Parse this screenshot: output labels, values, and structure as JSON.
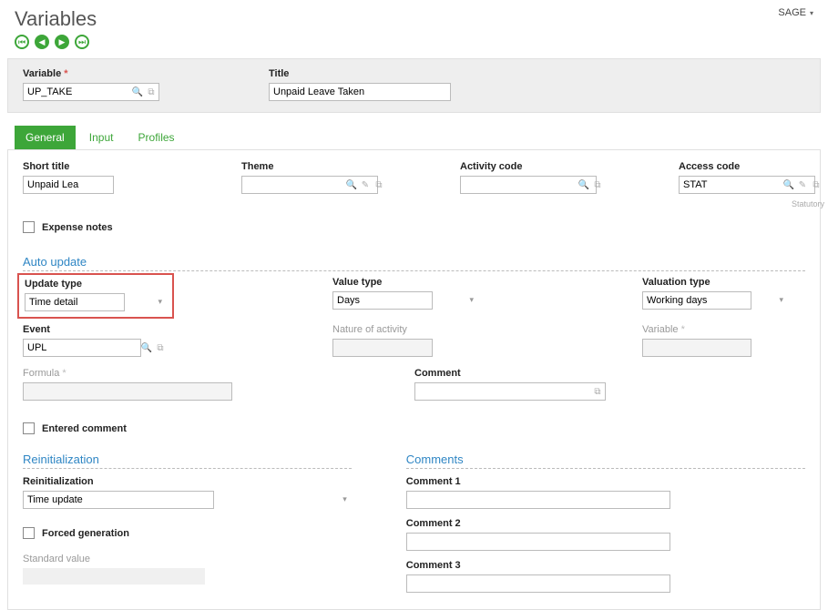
{
  "header": {
    "title": "Variables",
    "menu": "SAGE"
  },
  "topbar": {
    "variable_label": "Variable",
    "variable_value": "UP_TAKE",
    "title_label": "Title",
    "title_value": "Unpaid Leave Taken"
  },
  "tabs": {
    "general": "General",
    "input": "Input",
    "profiles": "Profiles"
  },
  "general": {
    "short_title_label": "Short title",
    "short_title_value": "Unpaid Lea",
    "theme_label": "Theme",
    "theme_value": "",
    "activity_code_label": "Activity code",
    "activity_code_value": "",
    "access_code_label": "Access code",
    "access_code_value": "STAT",
    "access_code_note": "Statutory",
    "expense_notes_label": "Expense notes",
    "auto_update_title": "Auto update",
    "update_type_label": "Update type",
    "update_type_value": "Time detail",
    "value_type_label": "Value type",
    "value_type_value": "Days",
    "valuation_type_label": "Valuation type",
    "valuation_type_value": "Working days",
    "event_label": "Event",
    "event_value": "UPL",
    "nature_label": "Nature of activity",
    "nature_value": "",
    "variable2_label": "Variable",
    "variable2_value": "",
    "formula_label": "Formula",
    "formula_value": "",
    "comment_label": "Comment",
    "comment_value": "",
    "entered_comment_label": "Entered comment",
    "reinit_title": "Reinitialization",
    "reinit_label": "Reinitialization",
    "reinit_value": "Time update",
    "forced_gen_label": "Forced generation",
    "standard_value_label": "Standard value",
    "comments_title": "Comments",
    "comment1_label": "Comment 1",
    "comment2_label": "Comment 2",
    "comment3_label": "Comment 3",
    "comment1_value": "",
    "comment2_value": "",
    "comment3_value": ""
  }
}
